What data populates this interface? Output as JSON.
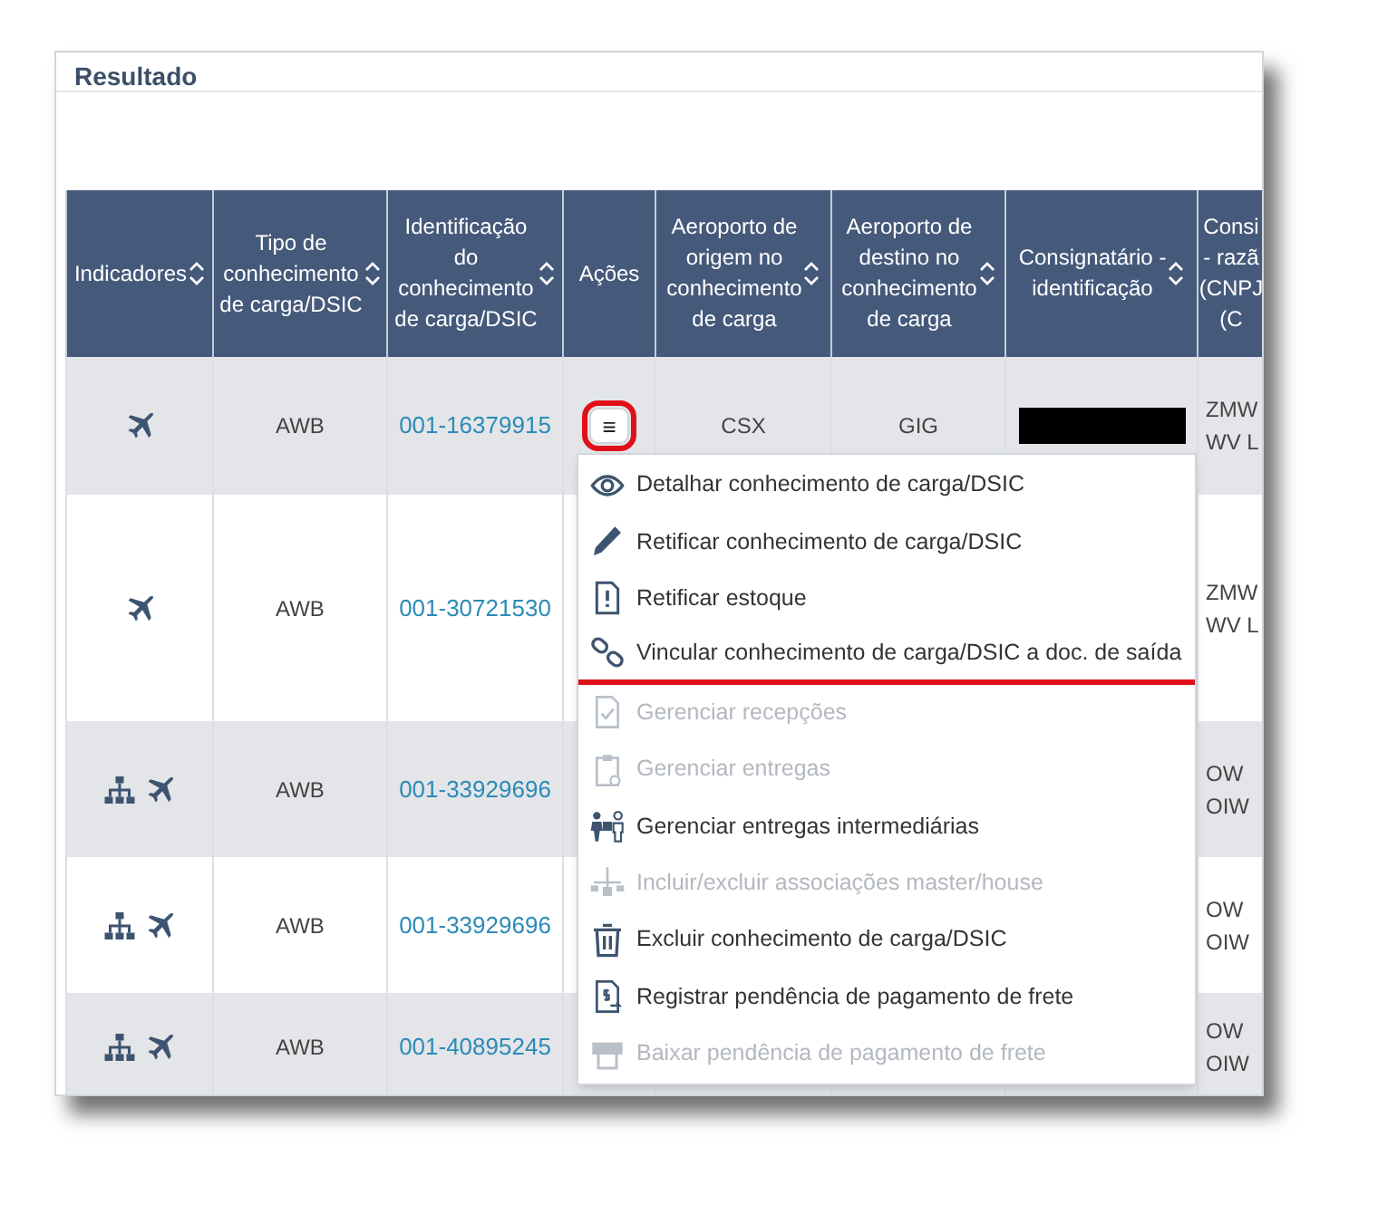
{
  "section_title": "Resultado",
  "table": {
    "columns": [
      {
        "lines": [
          "Indicadores"
        ],
        "sortable": true
      },
      {
        "lines": [
          "Tipo de",
          "conhecimento",
          "de carga/DSIC"
        ],
        "sortable": true
      },
      {
        "lines": [
          "Identificação",
          "do",
          "conhecimento",
          "de carga/DSIC"
        ],
        "sortable": true
      },
      {
        "lines": [
          "Ações"
        ],
        "sortable": false
      },
      {
        "lines": [
          "Aeroporto de",
          "origem no",
          "conhecimento",
          "de carga"
        ],
        "sortable": true
      },
      {
        "lines": [
          "Aeroporto de",
          "destino no",
          "conhecimento",
          "de carga"
        ],
        "sortable": true
      },
      {
        "lines": [
          "Consignatário -",
          "identificação"
        ],
        "sortable": true
      },
      {
        "lines": [
          "Consi",
          "- razã",
          "(CNPJ",
          "(C"
        ],
        "sortable": false
      }
    ],
    "rows": [
      {
        "indicators": [
          {
            "kind": "plane"
          }
        ],
        "type": "AWB",
        "id": "001-16379915",
        "action_button": {
          "label": "≡",
          "highlighted": true
        },
        "origin": "CSX",
        "destination": "GIG",
        "consignee": {
          "kind": "redacted"
        },
        "column_8": [
          "ZMW",
          "WV L"
        ]
      },
      {
        "indicators": [
          {
            "kind": "plane"
          }
        ],
        "type": "AWB",
        "id": "001-30721530",
        "column_8": [
          "ZMW",
          "WV L"
        ]
      },
      {
        "indicators": [
          {
            "kind": "hierarchy"
          },
          {
            "kind": "plane"
          }
        ],
        "type": "AWB",
        "id": "001-33929696",
        "column_8": [
          "OW",
          "OIW"
        ]
      },
      {
        "indicators": [
          {
            "kind": "hierarchy"
          },
          {
            "kind": "plane"
          }
        ],
        "type": "AWB",
        "id": "001-33929696",
        "column_8": [
          "OW",
          "OIW"
        ]
      },
      {
        "indicators": [
          {
            "kind": "hierarchy"
          },
          {
            "kind": "plane"
          }
        ],
        "type": "AWB",
        "id": "001-40895245",
        "column_8": [
          "OW",
          "OIW"
        ]
      }
    ]
  },
  "actions_menu": {
    "items": [
      {
        "label": "Detalhar conhecimento de carga/DSIC",
        "disabled": false,
        "highlighted": false
      },
      {
        "label": "Retificar conhecimento de carga/DSIC",
        "disabled": false,
        "highlighted": false
      },
      {
        "label": "Retificar estoque",
        "disabled": false,
        "highlighted": false
      },
      {
        "label": "Vincular conhecimento de carga/DSIC a doc. de saída",
        "disabled": false,
        "highlighted": true
      },
      {
        "label": "Gerenciar recepções",
        "disabled": true,
        "highlighted": false
      },
      {
        "label": "Gerenciar entregas",
        "disabled": true,
        "highlighted": false
      },
      {
        "label": "Gerenciar entregas intermediárias",
        "disabled": false,
        "highlighted": false
      },
      {
        "label": "Incluir/excluir associações master/house",
        "disabled": true,
        "highlighted": false
      },
      {
        "label": "Excluir conhecimento de carga/DSIC",
        "disabled": false,
        "highlighted": false
      },
      {
        "label": "Registrar pendência de pagamento de frete",
        "disabled": false,
        "highlighted": false
      },
      {
        "label": "Baixar pendência de pagamento de frete",
        "disabled": true,
        "highlighted": false
      }
    ]
  }
}
